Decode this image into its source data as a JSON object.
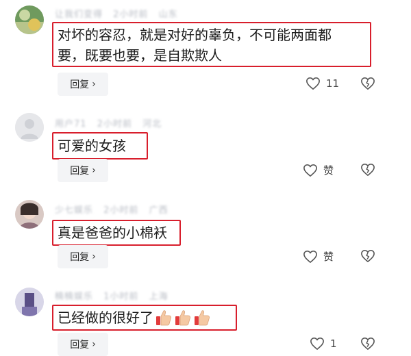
{
  "comments": [
    {
      "username": "让我们变得",
      "time": "2小时前",
      "location": "山东",
      "text_line1": "对坏的容忍，就是对好的辜负，不可能两面都",
      "text_line2": "要，既要也要，是自欺欺人",
      "reply_label": "回复",
      "like_count": "11"
    },
    {
      "username": "用户71",
      "time": "2小时前",
      "location": "河北",
      "text": "可爱的女孩",
      "reply_label": "回复",
      "like_count": "赞"
    },
    {
      "username": "少七娱乐",
      "time": "2小时前",
      "location": "广西",
      "text": "真是爸爸的小棉袄",
      "reply_label": "回复",
      "like_count": "赞"
    },
    {
      "username": "楠楠娱乐",
      "time": "1小时前",
      "location": "上海",
      "text": "已经做的很好了",
      "reply_label": "回复",
      "like_count": "1"
    }
  ],
  "icons": {
    "chevron": "›",
    "thumbs_up_emoji": "thumbs-up-emoji-icon"
  },
  "colors": {
    "highlight_border": "#d81e2c",
    "reply_bg": "#f3f4f6"
  }
}
